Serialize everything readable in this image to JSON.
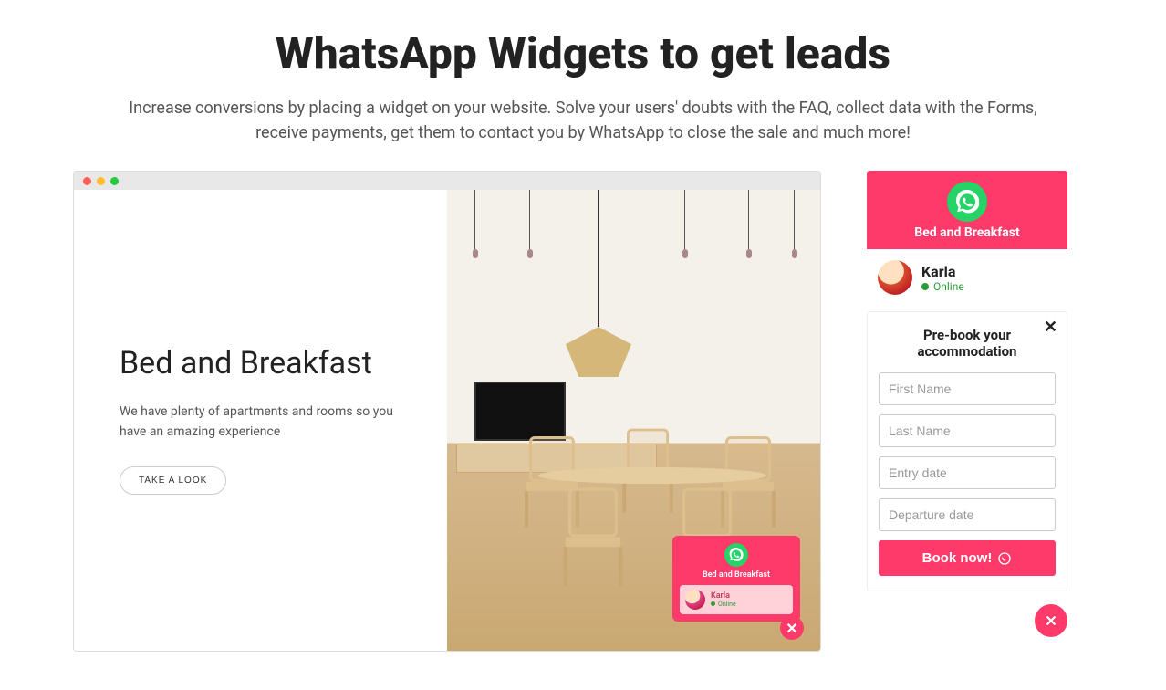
{
  "headline": "WhatsApp Widgets to get leads",
  "subhead": "Increase conversions by placing a widget on your website. Solve your users' doubts with the FAQ, collect data with the Forms, receive payments, get them to contact you by WhatsApp to close the sale and much more!",
  "colors": {
    "accent": "#fd3a69",
    "whatsapp": "#25d366",
    "online": "#2a9d3a"
  },
  "site": {
    "title": "Bed and Breakfast",
    "desc": "We have plenty of apartments and rooms so you have an amazing experience",
    "cta": "TAKE A LOOK"
  },
  "mini_widget": {
    "brand": "Bed and Breakfast",
    "agent_name": "Karla",
    "agent_status": "Online"
  },
  "panel": {
    "brand": "Bed and Breakfast",
    "agent_name": "Karla",
    "agent_status": "Online"
  },
  "form": {
    "title": "Pre-book your accommodation",
    "first_name_ph": "First Name",
    "last_name_ph": "Last Name",
    "entry_date_ph": "Entry date",
    "departure_date_ph": "Departure date",
    "submit": "Book now!"
  }
}
